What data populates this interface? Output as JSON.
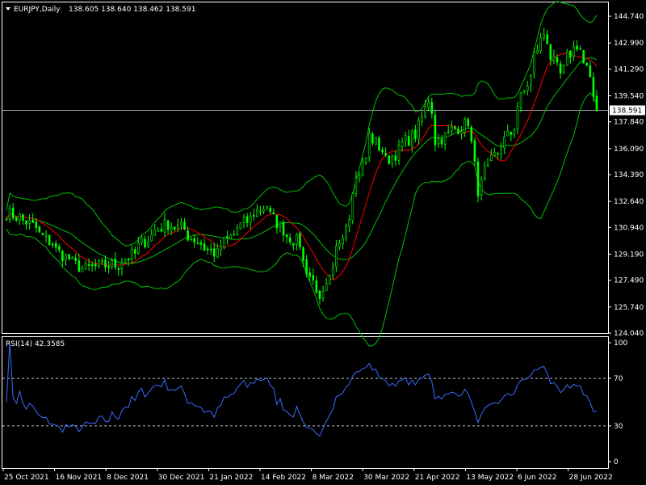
{
  "header": {
    "symbol": "EURJPY,Daily",
    "ohlc": "138.605 138.640 138.462 138.591"
  },
  "rsi_panel": {
    "label": "RSI(14) 42.3585"
  },
  "chart_data": [
    {
      "type": "candlestick",
      "symbol": "EURJPY",
      "timeframe": "Daily",
      "ylim": [
        124.04,
        145.64
      ],
      "yticks": [
        124.04,
        125.74,
        127.49,
        129.19,
        130.94,
        132.64,
        134.39,
        136.09,
        137.84,
        139.54,
        141.29,
        142.99,
        144.74
      ],
      "current_price": 138.591,
      "close_anchors": [
        [
          "2021-10-25",
          131.9
        ],
        [
          "2021-11-02",
          131.3
        ],
        [
          "2021-11-10",
          130.2
        ],
        [
          "2021-11-18",
          129.0
        ],
        [
          "2021-11-26",
          128.2
        ],
        [
          "2021-12-03",
          128.4
        ],
        [
          "2021-12-10",
          128.5
        ],
        [
          "2021-12-17",
          129.2
        ],
        [
          "2021-12-24",
          130.4
        ],
        [
          "2021-12-31",
          131.2
        ],
        [
          "2022-01-07",
          130.8
        ],
        [
          "2022-01-14",
          129.9
        ],
        [
          "2022-01-21",
          129.2
        ],
        [
          "2022-01-28",
          130.5
        ],
        [
          "2022-02-04",
          131.5
        ],
        [
          "2022-02-11",
          132.4
        ],
        [
          "2022-02-18",
          130.8
        ],
        [
          "2022-02-25",
          129.9
        ],
        [
          "2022-03-02",
          127.8
        ],
        [
          "2022-03-07",
          125.9
        ],
        [
          "2022-03-14",
          129.5
        ],
        [
          "2022-03-21",
          133.6
        ],
        [
          "2022-03-28",
          136.9
        ],
        [
          "2022-04-04",
          135.3
        ],
        [
          "2022-04-11",
          136.4
        ],
        [
          "2022-04-18",
          137.5
        ],
        [
          "2022-04-21",
          139.3
        ],
        [
          "2022-04-25",
          136.6
        ],
        [
          "2022-05-02",
          137.3
        ],
        [
          "2022-05-09",
          137.9
        ],
        [
          "2022-05-12",
          133.4
        ],
        [
          "2022-05-19",
          135.6
        ],
        [
          "2022-05-26",
          137.1
        ],
        [
          "2022-06-02",
          140.3
        ],
        [
          "2022-06-09",
          143.6
        ],
        [
          "2022-06-16",
          140.9
        ],
        [
          "2022-06-23",
          142.9
        ],
        [
          "2022-06-28",
          141.3
        ],
        [
          "2022-07-01",
          138.6
        ]
      ],
      "overlays": [
        "bollinger_bands",
        "moving_average"
      ],
      "colors": {
        "background": "#000000",
        "candle": "#00ff00",
        "bands": "#00c000",
        "moving_average": "#ff0000",
        "grid": "#808080",
        "text": "#ffffff"
      }
    },
    {
      "type": "line",
      "indicator": "RSI(14)",
      "ylim": [
        0,
        100
      ],
      "yticks": [
        0,
        30,
        70,
        100
      ],
      "levels": [
        30,
        70
      ],
      "last_value": 42.3585,
      "color": "#3a6cff"
    }
  ],
  "x_axis": {
    "labels": [
      "25 Oct 2021",
      "16 Nov 2021",
      "8 Dec 2021",
      "30 Dec 2021",
      "21 Jan 2022",
      "14 Feb 2022",
      "8 Mar 2022",
      "30 Mar 2022",
      "21 Apr 2022",
      "13 May 2022",
      "6 Jun 2022",
      "28 Jun 2022"
    ]
  }
}
